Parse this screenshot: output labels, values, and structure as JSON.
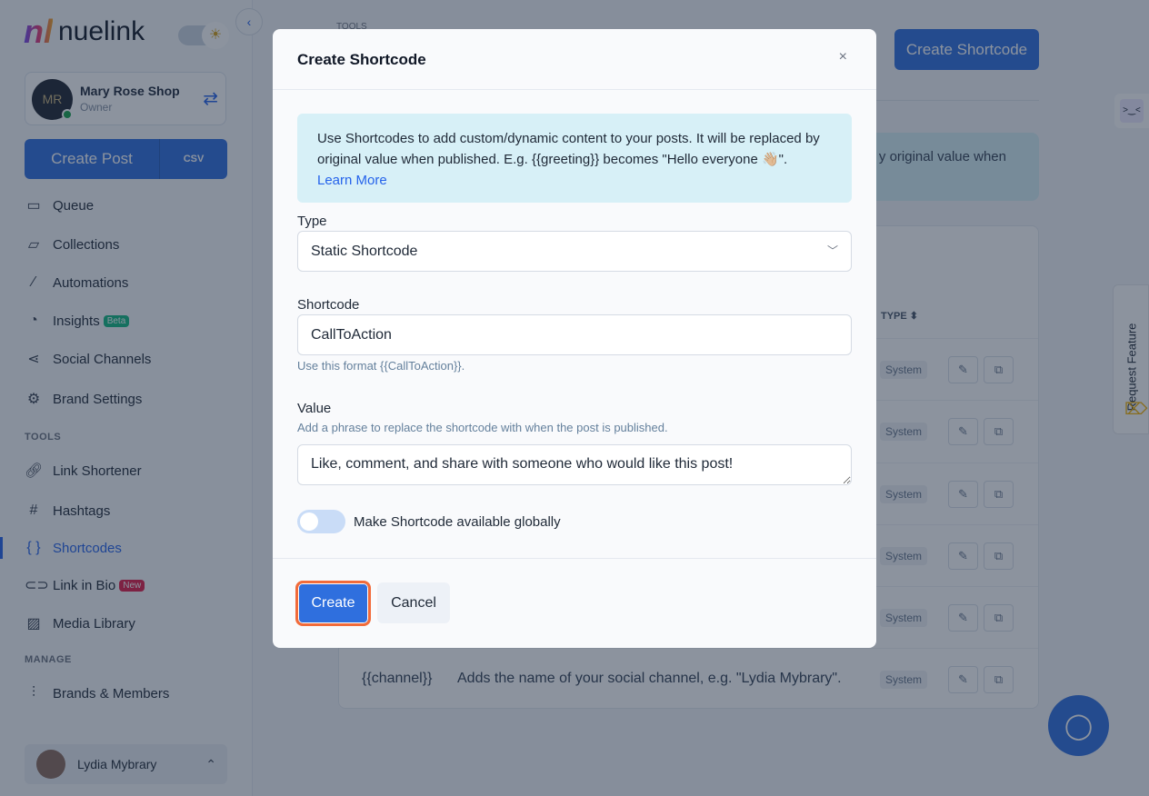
{
  "brand": {
    "name": "nuelink",
    "mark": "nl"
  },
  "account": {
    "name": "Mary Rose Shop",
    "role": "Owner",
    "initials": "MR"
  },
  "sidebar": {
    "create_post": "Create Post",
    "csv": "CSV",
    "items": [
      {
        "label": "Queue",
        "icon": "calendar-icon"
      },
      {
        "label": "Collections",
        "icon": "folder-icon"
      },
      {
        "label": "Automations",
        "icon": "magic-wand-icon"
      },
      {
        "label": "Insights",
        "icon": "pie-chart-icon",
        "badge": "Beta"
      },
      {
        "label": "Social Channels",
        "icon": "share-icon"
      },
      {
        "label": "Brand Settings",
        "icon": "gear-icon"
      }
    ],
    "tools_label": "TOOLS",
    "tools": [
      {
        "label": "Link Shortener"
      },
      {
        "label": "Hashtags"
      },
      {
        "label": "Shortcodes",
        "active": true
      },
      {
        "label": "Link in Bio",
        "badge": "New"
      },
      {
        "label": "Media Library"
      }
    ],
    "manage_label": "MANAGE",
    "manage": [
      {
        "label": "Brands & Members"
      }
    ],
    "user": "Lydia Mybrary"
  },
  "page": {
    "section": "TOOLS",
    "create_button": "Create Shortcode",
    "info_fragment": "y original value when",
    "type_header": "TYPE ⬍",
    "system": "System",
    "last_code": "{{channel}}",
    "last_desc": "Adds the name of your social channel, e.g. \"Lydia Mybrary\"."
  },
  "widgets": {
    "request_feature": "Request Feature"
  },
  "modal": {
    "title": "Create Shortcode",
    "close": "×",
    "info": "Use Shortcodes to add custom/dynamic content to your posts. It will be replaced by original value when published. E.g. {{greeting}} becomes \"Hello everyone 👋🏼\".",
    "learn_more": "Learn More",
    "type_label": "Type",
    "type_value": "Static Shortcode",
    "shortcode_label": "Shortcode",
    "shortcode_value": "CallToAction",
    "shortcode_hint": "Use this format {{CallToAction}}.",
    "value_label": "Value",
    "value_hint": "Add a phrase to replace the shortcode with when the post is published.",
    "value_value": "Like, comment, and share with someone who would like this post!",
    "global_label": "Make Shortcode available globally",
    "global_on": false,
    "create": "Create",
    "cancel": "Cancel"
  },
  "colors": {
    "accent": "#2f6fde",
    "focus_ring": "#f26b3a",
    "info_bg": "#d7f0f7"
  }
}
